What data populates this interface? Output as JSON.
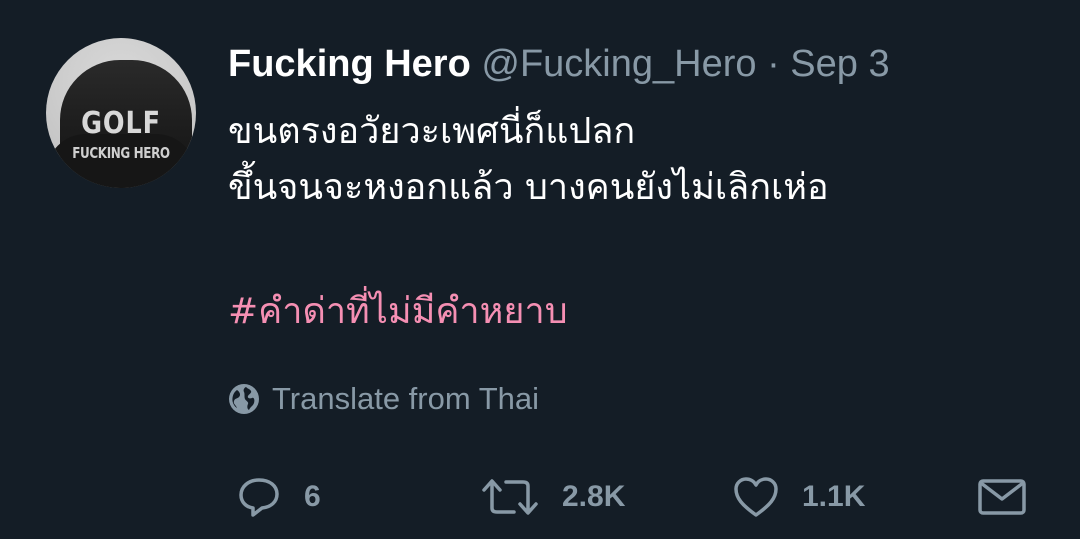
{
  "tweet": {
    "display_name": "Fucking Hero",
    "handle": "@Fucking_Hero",
    "separator": "·",
    "date": "Sep 3",
    "body_lines": [
      "ขนตรงอวัยวะเพศนี่ก็แปลก",
      "ขึ้นจนจะหงอกแล้ว บางคนยังไม่เลิกเห่อ"
    ],
    "hashtag": "#คำด่าที่ไม่มีคำหยาบ",
    "translate_label": "Translate from Thai",
    "avatar": {
      "text_top": "GOLF",
      "text_bottom": "FUCKING HERO"
    }
  },
  "actions": {
    "reply_count": "6",
    "retweet_count": "2.8K",
    "like_count": "1.1K"
  },
  "icons": {
    "globe": "globe-icon",
    "reply": "reply-icon",
    "retweet": "retweet-icon",
    "like": "heart-icon",
    "dm": "envelope-icon"
  },
  "colors": {
    "background": "#141d26",
    "primary_text": "#ffffff",
    "secondary_text": "#8899a6",
    "hashtag": "#f58fb3"
  }
}
